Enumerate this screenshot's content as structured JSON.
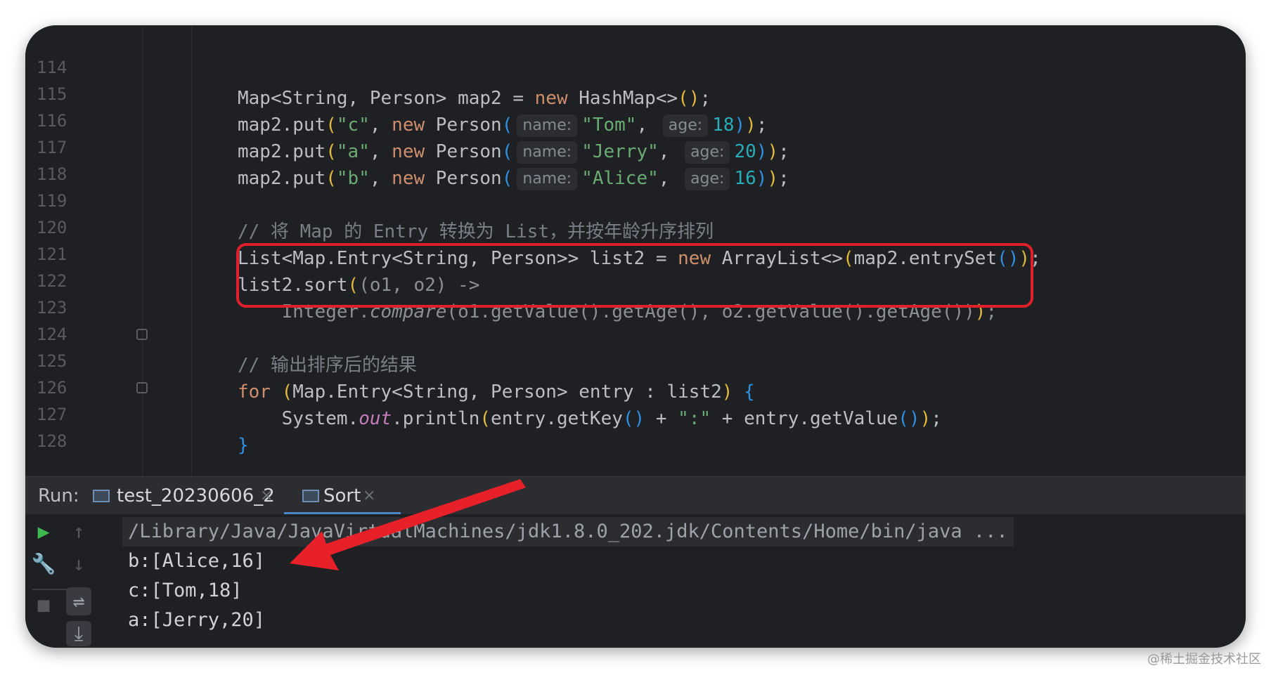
{
  "editor": {
    "lines": [
      {
        "no": "114",
        "code": "Map<String, Person> map2 = new HashMap<>();"
      },
      {
        "no": "115",
        "code": "map2.put(\"c\", new Person( name: \"Tom\",  age: 18));"
      },
      {
        "no": "116",
        "code": "map2.put(\"a\", new Person( name: \"Jerry\",  age: 20));"
      },
      {
        "no": "117",
        "code": "map2.put(\"b\", new Person( name: \"Alice\",  age: 16));"
      },
      {
        "no": "118",
        "code": ""
      },
      {
        "no": "119",
        "code": "// 将 Map 的 Entry 转换为 List，并按年龄升序排列"
      },
      {
        "no": "120",
        "code": "List<Map.Entry<String, Person>> list2 = new ArrayList<>(map2.entrySet());"
      },
      {
        "no": "121",
        "code": "list2.sort((o1, o2) ->"
      },
      {
        "no": "122",
        "code": "    Integer.compare(o1.getValue().getAge(), o2.getValue().getAge()));"
      },
      {
        "no": "123",
        "code": ""
      },
      {
        "no": "124",
        "code": "// 输出排序后的结果"
      },
      {
        "no": "125",
        "code": "for (Map.Entry<String, Person> entry : list2) {"
      },
      {
        "no": "126",
        "code": "    System.out.println(entry.getKey() + \":\" + entry.getValue());"
      },
      {
        "no": "127",
        "code": "}"
      },
      {
        "no": "128",
        "code": ""
      }
    ]
  },
  "run": {
    "label": "Run:",
    "tabs": [
      {
        "label": "test_20230606_2"
      },
      {
        "label": "Sort"
      }
    ],
    "close_glyph": "×"
  },
  "console": {
    "command": "/Library/Java/JavaVirtualMachines/jdk1.8.0_202.jdk/Contents/Home/bin/java ...",
    "output": [
      "b:[Alice,16]",
      "c:[Tom,18]",
      "a:[Jerry,20]"
    ]
  },
  "colors": {
    "highlight": "#e0202a",
    "arrow": "#e8202a",
    "run_green": "#3fb950"
  },
  "icons": [
    "play-icon",
    "wrench-icon",
    "stop-icon",
    "arrow-up-icon",
    "arrow-down-icon",
    "soft-wrap-icon",
    "scroll-to-end-icon"
  ],
  "watermark": "@稀土掘金技术社区"
}
